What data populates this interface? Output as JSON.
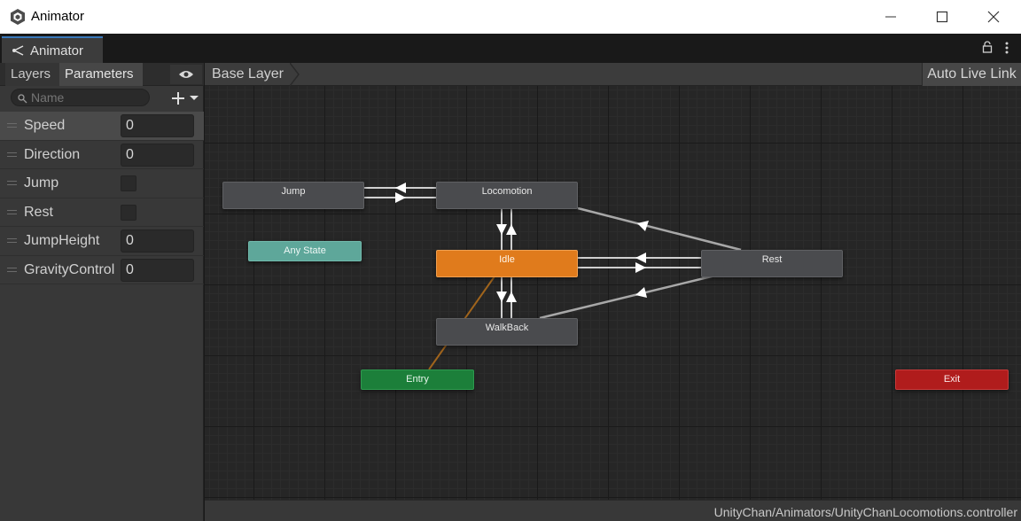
{
  "window": {
    "title": "Animator"
  },
  "tab": {
    "label": "Animator"
  },
  "left_panel": {
    "tabs": [
      "Layers",
      "Parameters"
    ],
    "search_placeholder": "Name",
    "parameters": [
      {
        "name": "Speed",
        "type": "float",
        "value": "0",
        "selected": true
      },
      {
        "name": "Direction",
        "type": "float",
        "value": "0"
      },
      {
        "name": "Jump",
        "type": "bool",
        "value": false
      },
      {
        "name": "Rest",
        "type": "bool",
        "value": false
      },
      {
        "name": "JumpHeight",
        "type": "float",
        "value": "0"
      },
      {
        "name": "GravityControl",
        "type": "float",
        "value": "0"
      }
    ]
  },
  "graph": {
    "breadcrumb": "Base Layer",
    "auto_live_link": "Auto Live Link",
    "states": {
      "jump": "Jump",
      "locomotion": "Locomotion",
      "any_state": "Any State",
      "idle": "Idle",
      "rest": "Rest",
      "walkback": "WalkBack",
      "entry": "Entry",
      "exit": "Exit"
    },
    "colors": {
      "default_state": "#e07b1c",
      "any_state": "#5ea79a",
      "entry": "#1c7f3a",
      "exit": "#b01c1c",
      "state": "#4a4b4e"
    }
  },
  "status": {
    "path": "UnityChan/Animators/UnityChanLocomotions.controller"
  }
}
